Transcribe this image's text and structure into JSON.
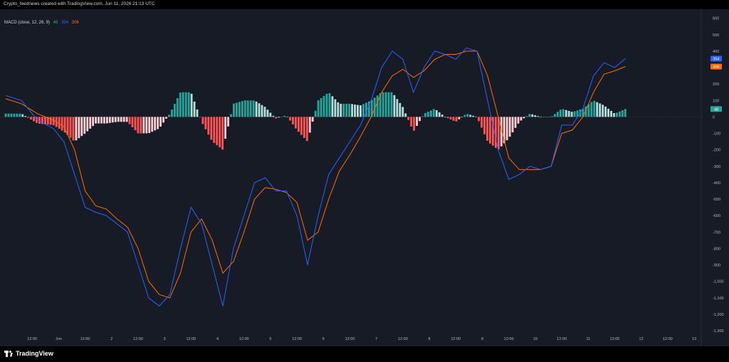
{
  "header": {
    "credit": "Crypto_feednews created with TradingView.com, Jun 11, 2026 21:13 UTC"
  },
  "legend": {
    "indicator": "MACD (close, 12, 26, 9)",
    "hist_value": "48",
    "macd_value": "354",
    "signal_value": "306"
  },
  "footer": {
    "brand": "TradingView"
  },
  "colors": {
    "background": "#171b26",
    "macd_line": "#2962ff",
    "signal_line": "#ff6d00",
    "hist_pos_strong": "#26a69a",
    "hist_pos_weak": "#b2dfdb",
    "hist_neg_strong": "#ff5252",
    "hist_neg_weak": "#ffcdd2",
    "axis_text": "#b2b5be"
  },
  "chart_data": {
    "type": "line",
    "title": "MACD (close, 12, 26, 9)",
    "ylim": [
      -1300,
      620
    ],
    "y_ticks": [
      600,
      500,
      400,
      300,
      200,
      100,
      0,
      -100,
      -200,
      -300,
      -400,
      -500,
      -600,
      -700,
      -800,
      -900,
      "-1,000",
      "-1,100",
      "-1,200",
      "-1,300"
    ],
    "x_ticks": [
      "12:00",
      "Jun",
      "12:00",
      "2",
      "12:00",
      "3",
      "12:00",
      "4",
      "12:00",
      "5",
      "12:00",
      "6",
      "12:00",
      "7",
      "12:00",
      "8",
      "12:00",
      "9",
      "12:00",
      "10",
      "12:00",
      "11",
      "12:00",
      "12",
      "12:00",
      "13"
    ],
    "x_tick_pos": [
      0.5,
      1,
      1.5,
      2,
      2.5,
      3,
      3.5,
      4,
      4.5,
      5,
      5.5,
      6,
      6.5,
      7,
      7.5,
      8,
      8.5,
      9,
      9.5,
      10,
      10.5,
      11,
      11.5,
      12,
      12.5,
      13
    ],
    "x_unit": "days since May 31",
    "last_values": {
      "macd": 354,
      "signal": 306,
      "histogram": 48
    },
    "grid": false,
    "series": [
      {
        "name": "MACD",
        "x": [
          0,
          0.3,
          0.6,
          0.9,
          1.1,
          1.3,
          1.5,
          1.7,
          1.9,
          2.1,
          2.3,
          2.5,
          2.7,
          2.9,
          3.1,
          3.3,
          3.5,
          3.7,
          3.9,
          4.1,
          4.3,
          4.5,
          4.7,
          4.9,
          5.1,
          5.3,
          5.5,
          5.7,
          5.9,
          6.1,
          6.3,
          6.5,
          6.7,
          6.9,
          7.1,
          7.3,
          7.5,
          7.7,
          7.9,
          8.1,
          8.3,
          8.5,
          8.7,
          8.9,
          9.1,
          9.3,
          9.5,
          9.7,
          9.9,
          10.1,
          10.3,
          10.5,
          10.7,
          10.9,
          11.1,
          11.3,
          11.5,
          11.7
        ],
        "values": [
          130,
          100,
          -20,
          -70,
          -150,
          -350,
          -550,
          -580,
          -600,
          -650,
          -700,
          -900,
          -1100,
          -1150,
          -1080,
          -800,
          -550,
          -650,
          -900,
          -1150,
          -800,
          -600,
          -400,
          -370,
          -450,
          -450,
          -600,
          -900,
          -600,
          -350,
          -250,
          -150,
          -50,
          100,
          300,
          400,
          350,
          150,
          300,
          400,
          380,
          350,
          420,
          400,
          100,
          -200,
          -380,
          -350,
          -300,
          -320,
          -300,
          -50,
          -50,
          50,
          250,
          330,
          300,
          354
        ]
      },
      {
        "name": "Signal",
        "x": [
          0,
          0.3,
          0.6,
          0.9,
          1.1,
          1.3,
          1.5,
          1.7,
          1.9,
          2.1,
          2.3,
          2.5,
          2.7,
          2.9,
          3.1,
          3.3,
          3.5,
          3.7,
          3.9,
          4.1,
          4.3,
          4.5,
          4.7,
          4.9,
          5.1,
          5.3,
          5.5,
          5.7,
          5.9,
          6.1,
          6.3,
          6.5,
          6.7,
          6.9,
          7.1,
          7.3,
          7.5,
          7.7,
          7.9,
          8.1,
          8.3,
          8.5,
          8.7,
          8.9,
          9.1,
          9.3,
          9.5,
          9.7,
          9.9,
          10.1,
          10.3,
          10.5,
          10.7,
          10.9,
          11.1,
          11.3,
          11.5,
          11.7
        ],
        "values": [
          110,
          80,
          20,
          -20,
          -60,
          -200,
          -450,
          -540,
          -560,
          -620,
          -670,
          -800,
          -1000,
          -1080,
          -1100,
          -950,
          -700,
          -620,
          -750,
          -950,
          -880,
          -700,
          -500,
          -430,
          -440,
          -460,
          -520,
          -750,
          -700,
          -500,
          -330,
          -230,
          -120,
          0,
          150,
          250,
          290,
          240,
          280,
          350,
          380,
          380,
          400,
          400,
          250,
          0,
          -250,
          -320,
          -320,
          -320,
          -300,
          -100,
          -80,
          0,
          150,
          260,
          280,
          306
        ]
      },
      {
        "name": "Histogram",
        "x": [
          0,
          0.3,
          0.6,
          0.9,
          1.1,
          1.3,
          1.5,
          1.7,
          1.9,
          2.1,
          2.3,
          2.5,
          2.7,
          2.9,
          3.1,
          3.3,
          3.5,
          3.7,
          3.9,
          4.1,
          4.3,
          4.5,
          4.7,
          4.9,
          5.1,
          5.3,
          5.5,
          5.7,
          5.9,
          6.1,
          6.3,
          6.5,
          6.7,
          6.9,
          7.1,
          7.3,
          7.5,
          7.7,
          7.9,
          8.1,
          8.3,
          8.5,
          8.7,
          8.9,
          9.1,
          9.3,
          9.5,
          9.7,
          9.9,
          10.1,
          10.3,
          10.5,
          10.7,
          10.9,
          11.1,
          11.3,
          11.5,
          11.7
        ],
        "values": [
          20,
          20,
          -40,
          -50,
          -90,
          -150,
          -100,
          -40,
          -40,
          -30,
          -30,
          -100,
          -100,
          -70,
          20,
          150,
          150,
          -30,
          -150,
          -200,
          80,
          100,
          100,
          60,
          -10,
          10,
          -80,
          -150,
          100,
          150,
          80,
          80,
          70,
          100,
          150,
          150,
          60,
          -90,
          20,
          50,
          0,
          -30,
          20,
          0,
          -150,
          -200,
          -130,
          -30,
          20,
          0,
          0,
          50,
          30,
          50,
          100,
          70,
          20,
          48
        ]
      }
    ]
  }
}
